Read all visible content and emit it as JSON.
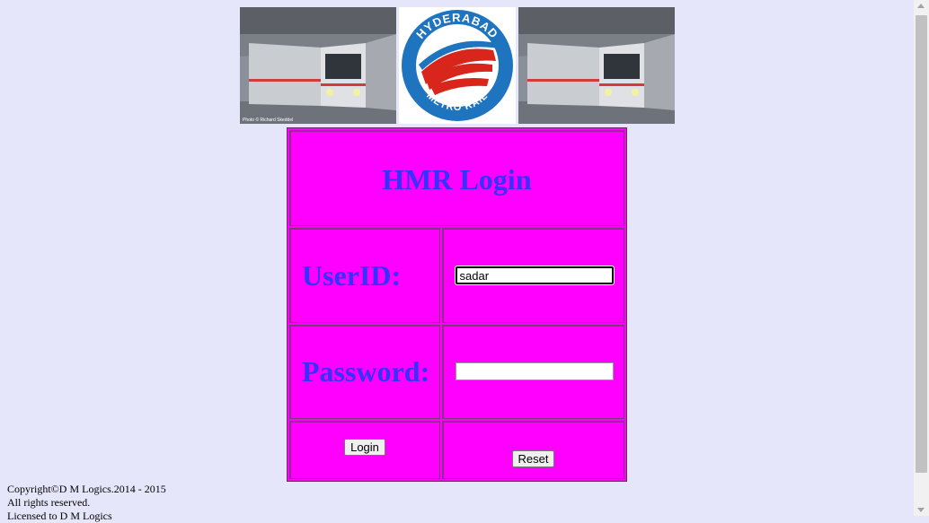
{
  "banner": {
    "logo_text_top": "HYDERABAD",
    "logo_text_bottom": "METRO RAIL",
    "photo_credit": "Photo © Richard Skeddel"
  },
  "login": {
    "title": "HMR Login",
    "userid_label": "UserID:",
    "userid_value": "sadar",
    "password_label": "Password:",
    "password_value": "",
    "login_button": "Login",
    "reset_button": "Reset"
  },
  "footer": {
    "line1": "Copyright©D M Logics.2014 - 2015",
    "line2": "All rights reserved.",
    "line3": "Licensed to D M Logics"
  },
  "colors": {
    "page_background": "#e6e6fa",
    "panel_background": "#ff00ff",
    "label_color": "#3333ff"
  }
}
